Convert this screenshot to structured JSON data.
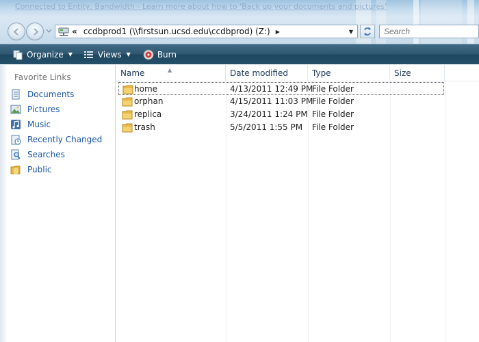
{
  "titlebar": {
    "background_link_text": "Connected to Entity,  Bandwidth - Learn more about how to 'Back up your documents and pictures'"
  },
  "address": {
    "chevron": "«",
    "path": "ccdbprod1 (\\\\firstsun.ucsd.edu\\ccdbprod) (Z:)"
  },
  "search": {
    "placeholder": "Search"
  },
  "toolbar": {
    "organize_label": "Organize",
    "views_label": "Views",
    "burn_label": "Burn"
  },
  "navpane": {
    "title": "Favorite Links",
    "items": [
      {
        "label": "Documents",
        "icon": "documents-icon"
      },
      {
        "label": "Pictures",
        "icon": "pictures-icon"
      },
      {
        "label": "Music",
        "icon": "music-icon"
      },
      {
        "label": "Recently Changed",
        "icon": "recently-changed-icon"
      },
      {
        "label": "Searches",
        "icon": "searches-icon"
      },
      {
        "label": "Public",
        "icon": "public-folder-icon"
      }
    ]
  },
  "columns": {
    "name": "Name",
    "date": "Date modified",
    "type": "Type",
    "size": "Size"
  },
  "files": [
    {
      "name": "home",
      "date": "4/13/2011 12:49 PM",
      "type": "File Folder",
      "size": ""
    },
    {
      "name": "orphan",
      "date": "4/15/2011 11:03 PM",
      "type": "File Folder",
      "size": ""
    },
    {
      "name": "replica",
      "date": "3/24/2011 1:24 PM",
      "type": "File Folder",
      "size": ""
    },
    {
      "name": "trash",
      "date": "5/5/2011 1:55 PM",
      "type": "File Folder",
      "size": ""
    }
  ],
  "colors": {
    "accent": "#1a55a8",
    "toolbar": "#2f5872",
    "folder": "#e8b94a"
  }
}
